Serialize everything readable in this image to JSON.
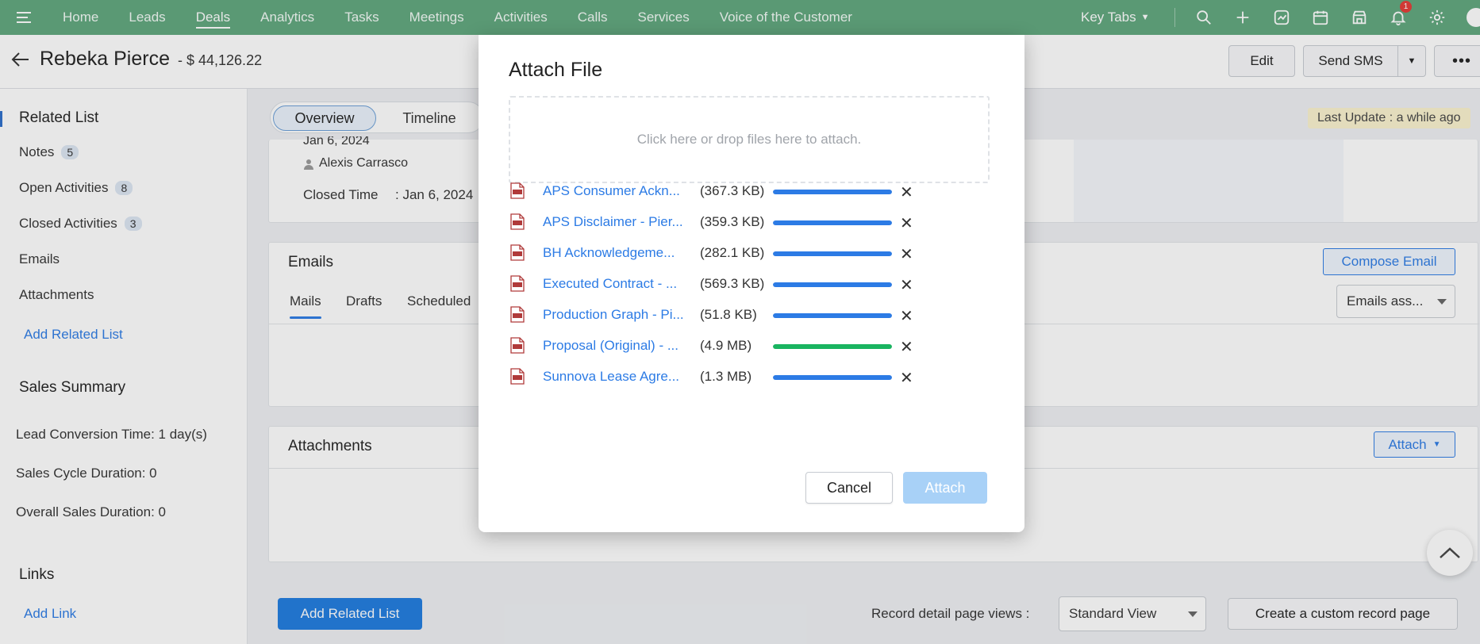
{
  "nav": {
    "items": [
      "Home",
      "Leads",
      "Deals",
      "Analytics",
      "Tasks",
      "Meetings",
      "Activities",
      "Calls",
      "Services",
      "Voice of the Customer"
    ],
    "active": "Deals",
    "key_tabs_label": "Key Tabs",
    "notification_count": "1"
  },
  "record": {
    "name": "Rebeka Pierce",
    "amount": "- $ 44,126.22",
    "edit_label": "Edit",
    "send_sms_label": "Send SMS"
  },
  "sidebar": {
    "related_list_title": "Related List",
    "items": [
      {
        "label": "Notes",
        "count": "5"
      },
      {
        "label": "Open Activities",
        "count": "8"
      },
      {
        "label": "Closed Activities",
        "count": "3"
      },
      {
        "label": "Emails",
        "count": ""
      },
      {
        "label": "Attachments",
        "count": ""
      }
    ],
    "add_related_list": "Add Related List",
    "sales_summary_title": "Sales Summary",
    "lead_conversion": "Lead Conversion Time: 1 day(s)",
    "sales_cycle": "Sales Cycle Duration: 0",
    "overall_sales": "Overall Sales Duration: 0",
    "links_title": "Links",
    "add_link": "Add Link"
  },
  "main": {
    "tabs": [
      "Overview",
      "Timeline"
    ],
    "last_update": "Last Update : a while ago",
    "partial_date": "Jan 6, 2024",
    "owner_name": "Alexis Carrasco",
    "closed_time_label": "Closed Time",
    "closed_time_value": ": Jan 6, 2024",
    "emails_title": "Emails",
    "compose_email": "Compose Email",
    "mail_tabs": [
      "Mails",
      "Drafts",
      "Scheduled"
    ],
    "emails_filter": "Emails ass...",
    "attachments_title": "Attachments",
    "attach_label": "Attach"
  },
  "footer": {
    "add_related_list": "Add Related List",
    "view_label": "Record detail page views :",
    "view_value": "Standard View",
    "custom_page": "Create a custom record page"
  },
  "modal": {
    "title": "Attach File",
    "dropzone_text": "Click here or drop files here to attach.",
    "files": [
      {
        "name": "APS Consumer Ackn...",
        "size": "(367.3 KB)",
        "progress": 100,
        "color": "#2c7be5"
      },
      {
        "name": "APS Disclaimer - Pier...",
        "size": "(359.3 KB)",
        "progress": 100,
        "color": "#2c7be5"
      },
      {
        "name": "BH Acknowledgeme...",
        "size": "(282.1 KB)",
        "progress": 100,
        "color": "#2c7be5"
      },
      {
        "name": "Executed Contract - ...",
        "size": "(569.3 KB)",
        "progress": 100,
        "color": "#2c7be5"
      },
      {
        "name": "Production Graph - Pi...",
        "size": "(51.8 KB)",
        "progress": 100,
        "color": "#2c7be5"
      },
      {
        "name": "Proposal (Original) - ...",
        "size": "(4.9 MB)",
        "progress": 100,
        "color": "#19b460"
      },
      {
        "name": "Sunnova Lease Agre...",
        "size": "(1.3 MB)",
        "progress": 100,
        "color": "#2c7be5"
      }
    ],
    "cancel_label": "Cancel",
    "attach_label": "Attach"
  },
  "colors": {
    "nav_bg": "#5fa77d",
    "accent": "#2c7be5",
    "attach_disabled": "#a8d1f7"
  }
}
